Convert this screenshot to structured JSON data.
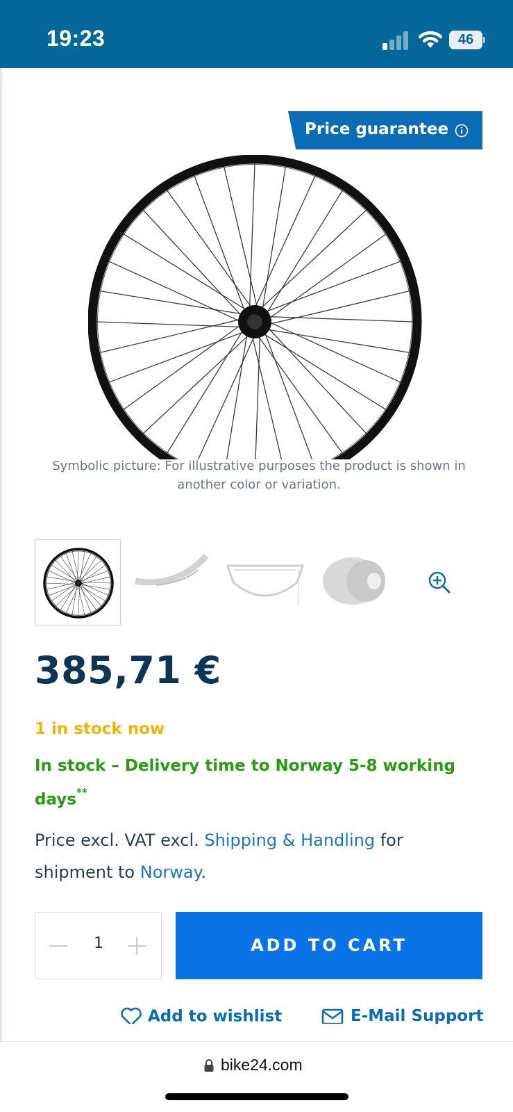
{
  "status_bar": {
    "time": "19:23",
    "battery": "46",
    "background": "#06679a"
  },
  "product": {
    "price_guarantee": "Price guarantee",
    "image_caption": "Symbolic picture: For illustrative purposes the product is shown in another color or variation.",
    "price": "385,71 €",
    "stock_now": "1 in stock now",
    "delivery": "In stock – Delivery time to Norway 5-8 working days",
    "delivery_note": "**",
    "vat": {
      "prefix": "Price excl. VAT excl.",
      "shipping_link": "Shipping & Handling",
      "middle": "for shipment to",
      "country_link": "Norway",
      "suffix": "."
    },
    "quantity": "1",
    "add_to_cart": "ADD TO CART",
    "wishlist": "Add to wishlist",
    "email_support": "E-Mail Support"
  },
  "browser": {
    "url": "bike24.com"
  },
  "colors": {
    "accent_blue": "#0a74e6",
    "price_blue": "#0d3556",
    "stock_yellow": "#f0b400",
    "delivery_green": "#2a9a12",
    "link_blue": "#1a78c2"
  },
  "icons": [
    "signal-icon",
    "wifi-icon",
    "battery-icon",
    "info-icon",
    "zoom-in-icon",
    "minus-icon",
    "plus-icon",
    "heart-icon",
    "mail-icon",
    "lock-icon"
  ]
}
